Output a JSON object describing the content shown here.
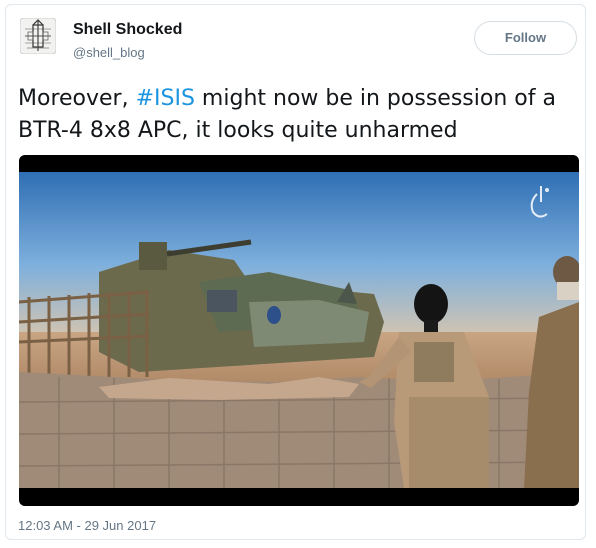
{
  "tweet": {
    "user": {
      "display_name": "Shell Shocked",
      "handle": "@shell_blog",
      "avatar_icon": "rocket-sketch-avatar-icon"
    },
    "follow_label": "Follow",
    "text_before_hashtag": "Moreover, ",
    "hashtag": "#ISIS",
    "text_after_hashtag": " might now be in possession of a BTR-4 8x8 APC, it looks quite unharmed",
    "media": {
      "type": "video-still",
      "watermark_icon": "media-logo-watermark-icon"
    },
    "timestamp": "12:03 AM - 29 Jun 2017"
  },
  "colors": {
    "link": "#1b95e0",
    "text": "#14171a",
    "muted": "#657786",
    "border": "#e1e8ed"
  }
}
